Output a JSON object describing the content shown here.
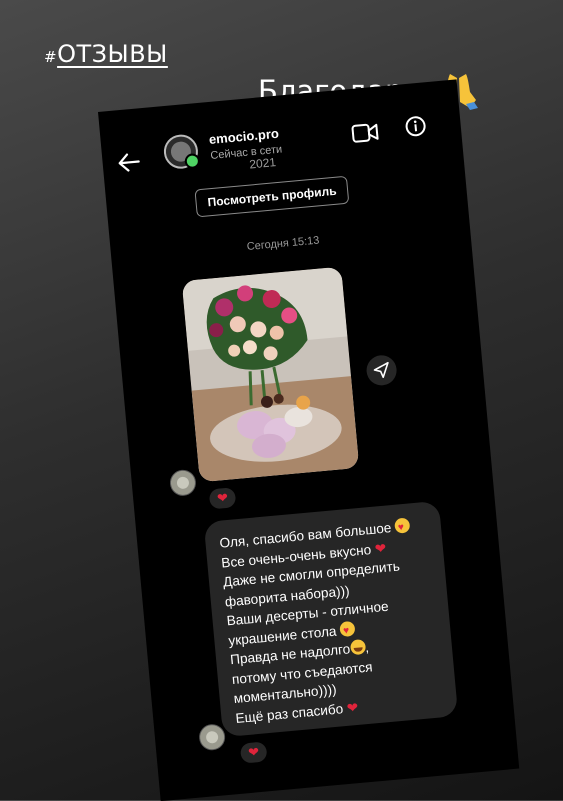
{
  "story": {
    "hashtag_symbol": "#",
    "hashtag_word": "отзывы",
    "caption": "Благодарю"
  },
  "chat_header": {
    "username": "emocio.pro",
    "status": "Сейчас в сети",
    "year_partial": "2021",
    "view_profile_label": "Посмотреть профиль"
  },
  "conversation": {
    "timestamp": "Сегодня 15:13",
    "photo_reaction": "❤",
    "message_reaction": "❤",
    "message_lines": [
      "Оля, спасибо вам большое",
      "Все очень-очень вкусно",
      "Даже не смогли определить",
      "фаворита набора)))",
      "Ваши десерты - отличное",
      "украшение стола",
      "Правда не надолго",
      "потому что съедаются",
      "моментально))))",
      "Ещё раз спасибо"
    ]
  },
  "colors": {
    "online": "#4fd364",
    "heart": "#e0243b",
    "bubble": "#262626"
  },
  "icons": [
    "back-arrow-icon",
    "video-call-icon",
    "info-icon",
    "share-icon",
    "pray-icon",
    "heart-icon"
  ]
}
